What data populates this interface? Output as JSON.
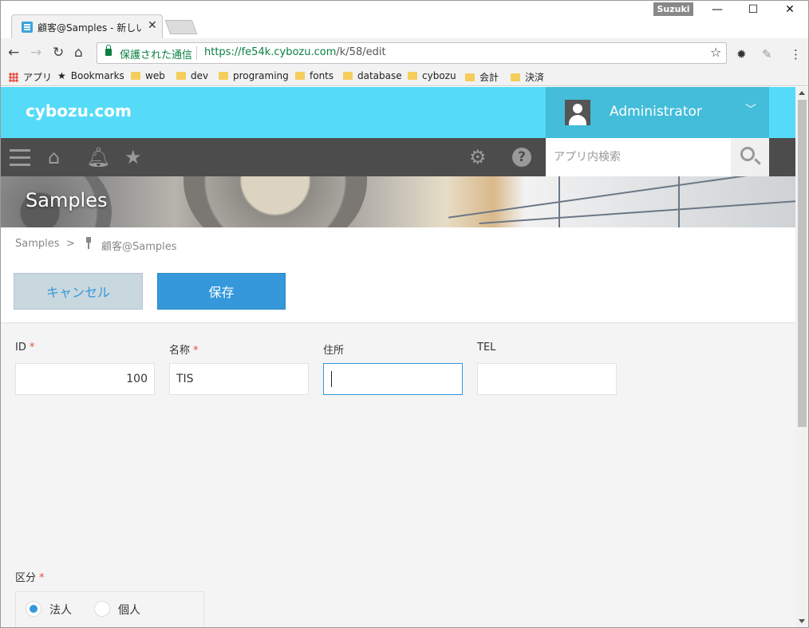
{
  "browser": {
    "tab_title": "顧客@Samples - 新しいレ",
    "profile": "Suzuki",
    "secure_label": "保護された通信",
    "url_main": "https://fe54k.cybozu.com",
    "url_path": "/k/58/edit",
    "bookmarks": [
      "アプリ",
      "Bookmarks",
      "web",
      "dev",
      "programing",
      "fonts",
      "database",
      "cybozu",
      "会計",
      "決済"
    ]
  },
  "header": {
    "logo": "cybozu.com",
    "user_name": "Administrator",
    "search_placeholder": "アプリ内検索",
    "banner_title": "Samples"
  },
  "breadcrumb": {
    "space": "Samples",
    "separator": ">",
    "app": "顧客@Samples"
  },
  "actions": {
    "cancel": "キャンセル",
    "save": "保存"
  },
  "form": {
    "required_mark": "*",
    "id": {
      "label": "ID",
      "value": "100"
    },
    "name": {
      "label": "名称",
      "value": "TIS"
    },
    "address": {
      "label": "住所",
      "value": ""
    },
    "tel": {
      "label": "TEL",
      "value": ""
    },
    "category": {
      "label": "区分",
      "options": [
        "法人",
        "個人"
      ],
      "selected": "法人"
    }
  },
  "colors": {
    "header": "#55dbf8",
    "user_panel": "#43bdd9",
    "toolbar": "#4c4c4c",
    "primary": "#3498db",
    "required": "#e74c3c"
  }
}
